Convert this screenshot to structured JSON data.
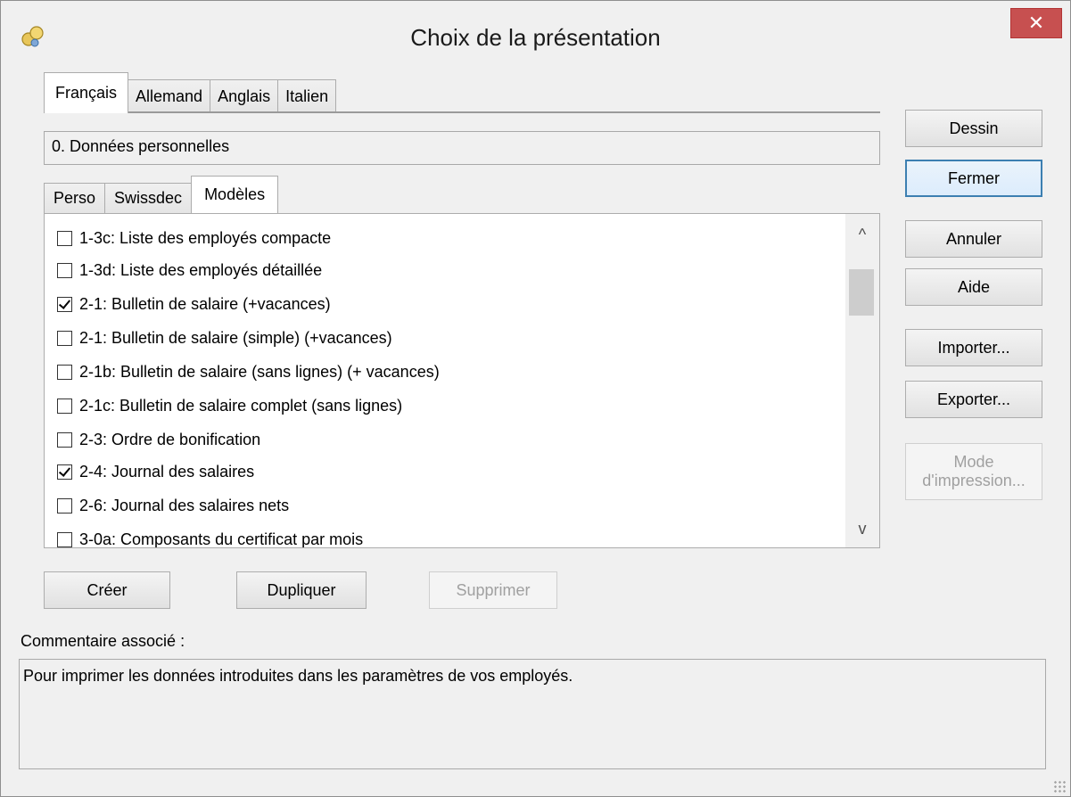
{
  "window": {
    "title": "Choix de la présentation",
    "close_label": "✕"
  },
  "language_tabs": [
    {
      "label": "Français",
      "active": true
    },
    {
      "label": "Allemand",
      "active": false
    },
    {
      "label": "Anglais",
      "active": false
    },
    {
      "label": "Italien",
      "active": false
    }
  ],
  "category_field": {
    "value": "0. Données personnelles"
  },
  "sub_tabs": [
    {
      "label": "Perso",
      "active": false
    },
    {
      "label": "Swissdec",
      "active": false
    },
    {
      "label": "Modèles",
      "active": true
    }
  ],
  "list": {
    "items": [
      {
        "label": "1-3c: Liste des employés compacte",
        "checked": false
      },
      {
        "label": "1-3d: Liste des employés détaillée",
        "checked": false
      },
      {
        "label": "2-1: Bulletin de salaire (+vacances)",
        "checked": true
      },
      {
        "label": "2-1: Bulletin de salaire (simple) (+vacances)",
        "checked": false
      },
      {
        "label": "2-1b: Bulletin de salaire (sans lignes) (+ vacances)",
        "checked": false
      },
      {
        "label": "2-1c: Bulletin de salaire complet (sans lignes)",
        "checked": false
      },
      {
        "label": "2-3: Ordre de bonification",
        "checked": false
      },
      {
        "label": "2-4: Journal des salaires",
        "checked": true
      },
      {
        "label": "2-6: Journal des salaires nets",
        "checked": false
      },
      {
        "label": "3-0a: Composants du certificat par mois",
        "checked": false
      }
    ],
    "scroll_up": "^",
    "scroll_down": "v"
  },
  "right_buttons": {
    "dessin": "Dessin",
    "fermer": "Fermer",
    "annuler": "Annuler",
    "aide": "Aide",
    "importer": "Importer...",
    "exporter": "Exporter...",
    "mode_line1": "Mode",
    "mode_line2": "d'impression..."
  },
  "bottom_buttons": {
    "creer": "Créer",
    "dupliquer": "Dupliquer",
    "supprimer": "Supprimer"
  },
  "comment": {
    "label": "Commentaire associé :",
    "text": "Pour imprimer les données introduites dans les paramètres de vos employés."
  }
}
